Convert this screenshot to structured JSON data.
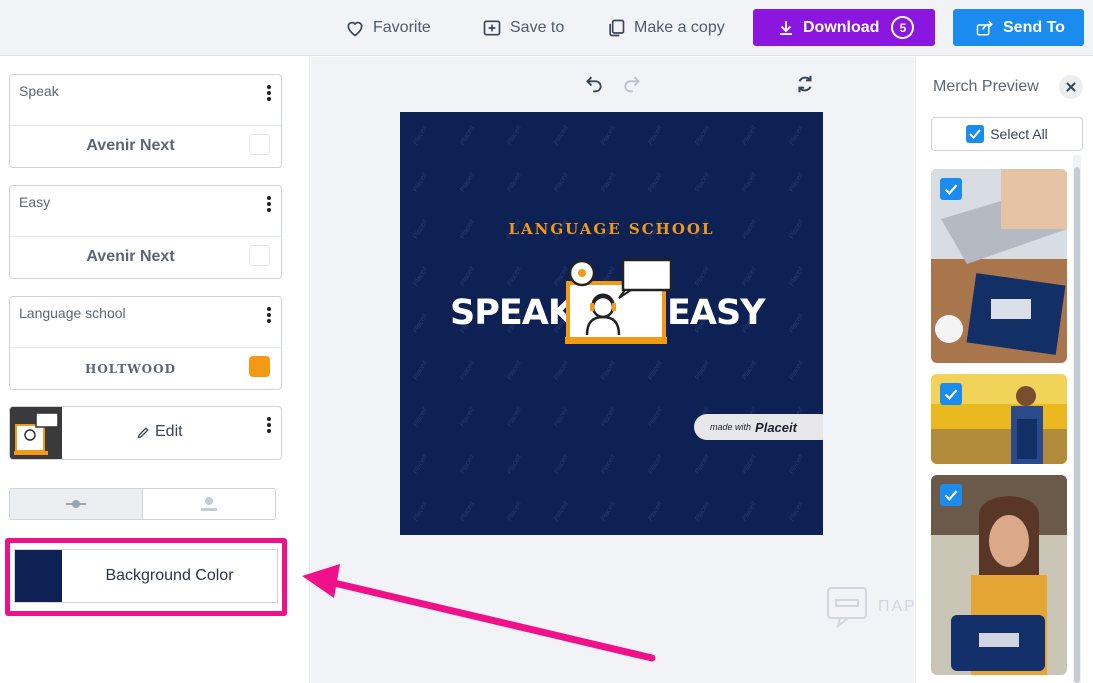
{
  "topbar": {
    "favorite_label": "Favorite",
    "save_label": "Save to",
    "copy_label": "Make a copy",
    "download_label": "Download",
    "download_count": "5",
    "send_label": "Send To"
  },
  "layers": [
    {
      "label": "Speak",
      "font": "Avenir Next",
      "color": "#ffffff"
    },
    {
      "label": "Easy",
      "font": "Avenir Next",
      "color": "#ffffff"
    },
    {
      "label": "Language school",
      "font": "HOLTWOOD",
      "color": "#f39a15"
    }
  ],
  "graphic": {
    "edit_label": "Edit"
  },
  "background": {
    "label": "Background Color",
    "color": "#0d2155"
  },
  "design": {
    "top_text": "LANGUAGE SCHOOL",
    "word_left": "SPEAK",
    "word_right": "EASY",
    "badge_small": "made with",
    "badge_brand": "Placeit"
  },
  "watermark": {
    "text": "ПАР"
  },
  "merch": {
    "title": "Merch Preview",
    "select_all_label": "Select All"
  },
  "colors": {
    "accent_purple": "#8a16e0",
    "accent_blue": "#1a8cf0",
    "highlight_pink": "#f0108a",
    "navy": "#0d2155",
    "orange": "#f39a15"
  }
}
